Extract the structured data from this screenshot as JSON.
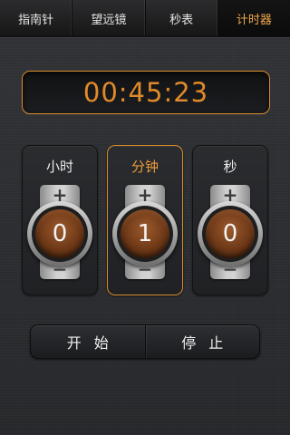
{
  "tabs": [
    {
      "label": "指南针",
      "active": false
    },
    {
      "label": "望远镜",
      "active": false
    },
    {
      "label": "秒表",
      "active": false
    },
    {
      "label": "计时器",
      "active": true
    }
  ],
  "display": {
    "time": "00:45:23"
  },
  "columns": [
    {
      "label": "小时",
      "value": "0",
      "active": false
    },
    {
      "label": "分钟",
      "value": "1",
      "active": true
    },
    {
      "label": "秒",
      "value": "0",
      "active": false
    }
  ],
  "stepper": {
    "plus": "+",
    "minus": "−"
  },
  "buttons": {
    "start": "开始",
    "stop": "停止"
  },
  "colors": {
    "accent": "#e08a2a",
    "background": "#2b2d30",
    "dial": "#6d3817"
  }
}
